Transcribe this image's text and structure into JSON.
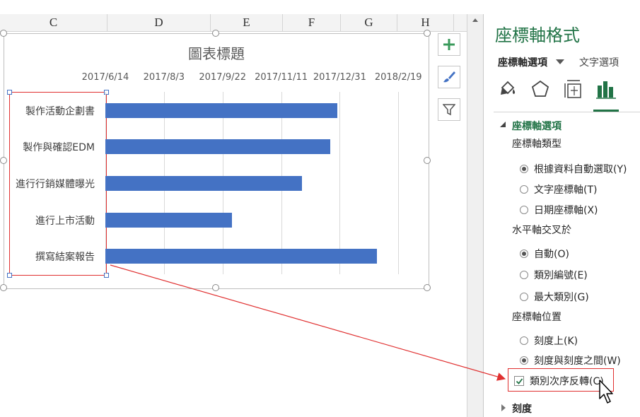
{
  "sheet": {
    "columns": [
      "C",
      "D",
      "E",
      "F",
      "G",
      "H"
    ]
  },
  "chart": {
    "title": "圖表標題",
    "side_buttons": [
      "chart-elements-icon",
      "chart-styles-icon",
      "chart-filters-icon"
    ]
  },
  "chart_data": {
    "type": "bar",
    "orientation": "horizontal",
    "title": "圖表標題",
    "categories": [
      "製作活動企劃書",
      "製作與確認EDM",
      "進行行銷媒體曝光",
      "進行上市活動",
      "撰寫結案報告"
    ],
    "x_tick_labels": [
      "2017/6/14",
      "2017/8/3",
      "2017/9/22",
      "2017/11/11",
      "2017/12/31",
      "2018/2/19"
    ],
    "x_axis_position": "top",
    "xlim": [
      "2017/6/14",
      "2018/3/15"
    ],
    "series": [
      {
        "values": [
          "2017/12/29",
          "2017/12/23",
          "2017/11/29",
          "2017/9/30",
          "2018/2/1"
        ]
      }
    ],
    "bar_color": "#4472c4",
    "grid": true,
    "legend": "none"
  },
  "pane": {
    "title": "座標軸格式",
    "tab_axis_options": "座標軸選項",
    "tab_text_options": "文字選項",
    "icons": [
      "fill-line-icon",
      "effects-icon",
      "size-properties-icon",
      "axis-options-icon"
    ],
    "section_axis_options": "座標軸選項",
    "axis_type_label": "座標軸類型",
    "axis_type_options": [
      "根據資料自動選取(Y)",
      "文字座標軸(T)",
      "日期座標軸(X)"
    ],
    "axis_type_selected": 0,
    "crosses_label": "水平軸交叉於",
    "crosses_options": [
      "自動(O)",
      "類別編號(E)",
      "最大類別(G)"
    ],
    "crosses_selected": 0,
    "axis_position_label": "座標軸位置",
    "axis_position_options": [
      "刻度上(K)",
      "刻度與刻度之間(W)"
    ],
    "axis_position_selected": 1,
    "reverse_order_label": "類別次序反轉(C)",
    "reverse_order_checked": true,
    "section_ticks": "刻度"
  },
  "colors": {
    "accent": "#217346",
    "bar": "#4472c4",
    "highlight": "#e03030"
  }
}
